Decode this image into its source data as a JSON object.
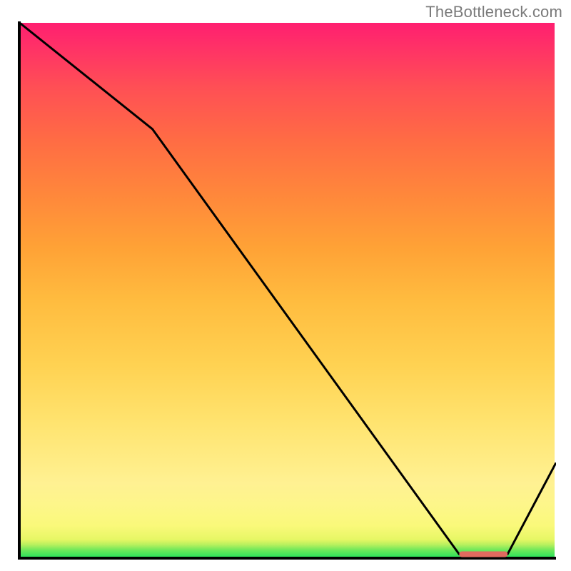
{
  "watermark": "TheBottleneck.com",
  "colors": {
    "axis": "#000000",
    "line": "#000000",
    "marker": "#e06a5f",
    "gradient_top": "#ff1f70",
    "gradient_bottom": "#22e05b"
  },
  "chart_data": {
    "type": "line",
    "title": "",
    "xlabel": "",
    "ylabel": "",
    "xlim": [
      0,
      100
    ],
    "ylim": [
      0,
      100
    ],
    "x": [
      0,
      25,
      82,
      91,
      100
    ],
    "values": [
      100,
      80,
      1,
      1,
      18
    ],
    "marker": {
      "x_start": 82,
      "x_end": 91,
      "y": 1
    },
    "background": "vertical-gradient",
    "grid": false,
    "legend": false
  }
}
